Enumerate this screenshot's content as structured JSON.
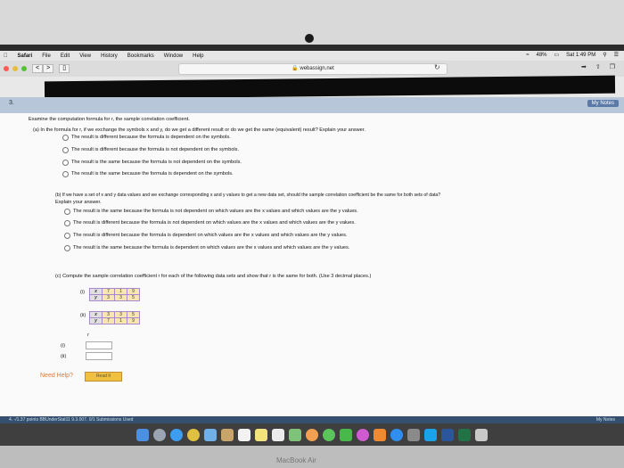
{
  "menubar": {
    "apple": "",
    "items": [
      "Safari",
      "File",
      "Edit",
      "View",
      "History",
      "Bookmarks",
      "Window",
      "Help"
    ],
    "battery": "48%",
    "clock": "Sat 1:49 PM"
  },
  "browser": {
    "url": "webassign.net",
    "back": "<",
    "forward": ">"
  },
  "banner": {
    "question_number": "3.",
    "my_notes": "My Notes"
  },
  "question": {
    "intro": "Examine the computation formula for r, the sample correlation coefficient.",
    "part_a": {
      "prompt": "(a) In the formula for r, if we exchange the symbols x and y, do we get a different result or do we get the same (equivalent) result? Explain your answer.",
      "options": [
        "The result is different because the formula is dependent on the symbols.",
        "The result is different because the formula is not dependent on the symbols.",
        "The result is the same because the formula is not dependent on the symbols.",
        "The result is the same because the formula is dependent on the symbols."
      ]
    },
    "part_b": {
      "prompt": "(b) If we have a set of x and y data values and we exchange corresponding x and y values to get a new data set, should the sample correlation coefficient be the same for both sets of data?",
      "prompt2": "Explain your answer.",
      "options": [
        "The result is the same because the formula is not dependent on which values are the x values and which values are the y values.",
        "The result is different because the formula is not dependent on which values are the x values and which values are the y values.",
        "The result is different because the formula is dependent on which values are the x values and which values are the y values.",
        "The result is the same because the formula is dependent on which values are the x values and which values are the y values."
      ]
    },
    "part_c": {
      "prompt": "(c) Compute the sample correlation coefficient r for each of the following data sets and show that r is the same for both. (Use 3 decimal places.)",
      "set_i": {
        "label": "(i)",
        "x_label": "x",
        "y_label": "y",
        "x": [
          "7",
          "1",
          "9"
        ],
        "y": [
          "3",
          "3",
          "5"
        ]
      },
      "set_ii": {
        "label": "(ii)",
        "x_label": "x",
        "y_label": "y",
        "x": [
          "3",
          "3",
          "5"
        ],
        "y": [
          "7",
          "1",
          "9"
        ]
      },
      "r_label": "r",
      "answer_labels": [
        "(i)",
        "(ii)"
      ]
    },
    "help_label": "Need Help?",
    "read_it": "Read It"
  },
  "footer": {
    "text": "4.  -/1.37 points   BBUnderStat11 9.3.007.   0/1 Submissions Used",
    "my_notes": "My Notes"
  },
  "laptop": {
    "brand": "MacBook Air"
  },
  "colors": {
    "banner": "#b7c7d9",
    "help": "#e07a2c",
    "table_header": "#e0e0e0",
    "table_value": "#f7e6b0"
  },
  "dock_icons": [
    "finder-icon",
    "launchpad-icon",
    "safari-icon",
    "chrome-icon",
    "mail-icon",
    "contacts-icon",
    "calendar-icon",
    "notes-icon",
    "reminders-icon",
    "maps-icon",
    "photos-icon",
    "messages-icon",
    "facetime-icon",
    "itunes-icon",
    "ibooks-icon",
    "appstore-icon",
    "preferences-icon",
    "skype-icon",
    "word-icon",
    "excel-icon",
    "trash-icon"
  ]
}
